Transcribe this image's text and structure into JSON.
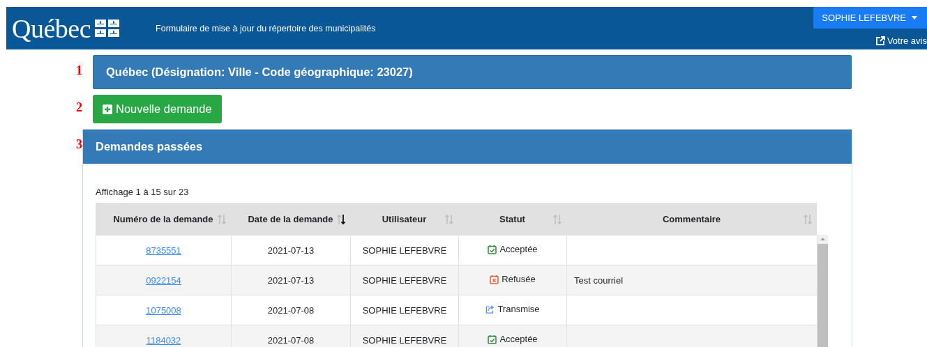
{
  "header": {
    "logo": "Québec",
    "title": "Formulaire de mise à jour du répertoire des municipalités",
    "user_menu": "SOPHIE LEFEBVRE",
    "feedback_link": "Votre avis"
  },
  "steps": [
    {
      "number": "1"
    },
    {
      "number": "2"
    },
    {
      "number": "3"
    }
  ],
  "municipality_panel": {
    "title": "Québec (Désignation: Ville - Code géographique: 23027)"
  },
  "new_request_button": {
    "label": "Nouvelle demande"
  },
  "past_requests": {
    "title": "Demandes passées",
    "info": "Affichage 1 à 15 sur 23",
    "table": {
      "columns": [
        {
          "label": "Numéro de la demande",
          "sorted": false
        },
        {
          "label": "Date de la demande",
          "sorted": true
        },
        {
          "label": "Utilisateur",
          "sorted": false
        },
        {
          "label": "Statut",
          "sorted": false
        },
        {
          "label": "Commentaire",
          "sorted": false
        }
      ],
      "rows": [
        {
          "number": "8735551",
          "date": "2021-07-13",
          "user": "SOPHIE LEFEBVRE",
          "status": {
            "kind": "accepted",
            "label": "Acceptée"
          }
        },
        {
          "number": "0922154",
          "date": "2021-07-13",
          "user": "SOPHIE LEFEBVRE",
          "status": {
            "kind": "refused",
            "label": "Refusée"
          },
          "comment": "Test courriel"
        },
        {
          "number": "1075008",
          "date": "2021-07-08",
          "user": "SOPHIE LEFEBVRE",
          "status": {
            "kind": "transmitted",
            "label": "Transmise"
          }
        },
        {
          "number": "1184032",
          "date": "2021-07-08",
          "user": "SOPHIE LEFEBVRE",
          "status": {
            "kind": "accepted",
            "label": "Acceptée"
          }
        }
      ]
    }
  }
}
